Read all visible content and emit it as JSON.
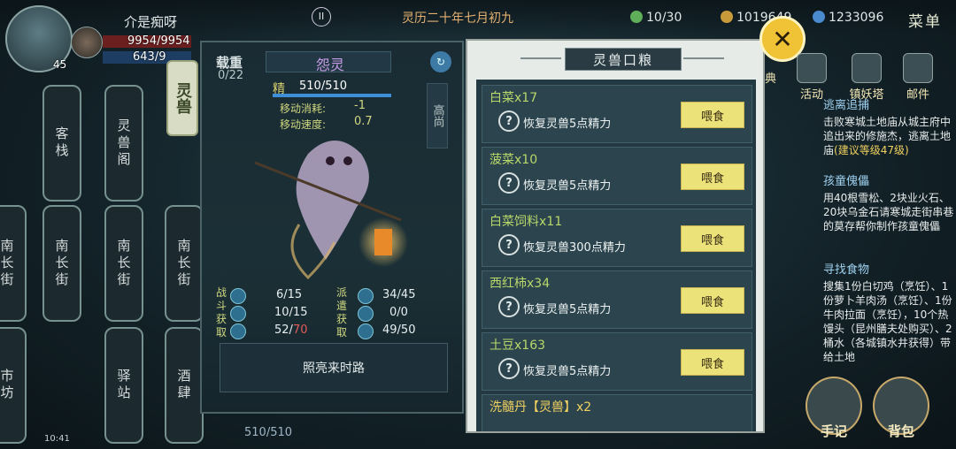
{
  "hud": {
    "player_name": "介是痴呀",
    "hp": "9954/9954",
    "mp": "643/9",
    "level": "45",
    "calendar": "灵历二十年七月初九",
    "stamina_res": "10/30",
    "copper": "1019649",
    "silver": "1233096",
    "menu_label": "菜单",
    "clock": "10:41"
  },
  "map": {
    "tab_label": "灵兽",
    "nodes": [
      "客栈",
      "灵兽阁",
      "南长街",
      "南长街",
      "南长街",
      "南长街",
      "驿站",
      "酒肆",
      "市坊"
    ]
  },
  "pet": {
    "weight_label": "载重",
    "weight_value": "0/22",
    "name": "怨灵",
    "stamina_label": "精",
    "stamina": "510/510",
    "move_cost_label": "移动消耗:",
    "move_cost": "-1",
    "move_speed_label": "移动速度:",
    "move_speed": "0.7",
    "side_tag": "高尚",
    "battle_label": "战斗获取",
    "dispatch_label": "派遣获取",
    "battle": [
      "6/15",
      "10/15",
      "52",
      "70"
    ],
    "dispatch": [
      "34/45",
      "0/0",
      "49/50"
    ],
    "skill": "照亮来时路",
    "below_stamina": "510/510"
  },
  "food_panel": {
    "title": "灵兽口粮",
    "feed_label": "喂食",
    "items": [
      {
        "name": "白菜x17",
        "desc": "恢复灵兽5点精力"
      },
      {
        "name": "菠菜x10",
        "desc": "恢复灵兽5点精力"
      },
      {
        "name": "白菜饲料x11",
        "desc": "恢复灵兽300点精力"
      },
      {
        "name": "西红柿x34",
        "desc": "恢复灵兽5点精力"
      },
      {
        "name": "土豆x163",
        "desc": "恢复灵兽5点精力"
      },
      {
        "name": "洗髓丹【灵兽】x2",
        "desc": ""
      }
    ]
  },
  "side_menu": {
    "buttons": [
      "活动",
      "镇妖塔",
      "邮件"
    ],
    "partial_left": "典",
    "big_buttons": [
      "手记",
      "背包"
    ]
  },
  "quests": [
    {
      "title": "逃离追捕",
      "text": "击败寒城土地庙从城主府中追出来的修施杰，逃离土地庙",
      "hint": "(建议等级47级)"
    },
    {
      "title": "孩童傀儡",
      "text": "用40根雪松、2块业火石、20块乌金石请寒城走街串巷的莫存帮你制作孩童傀儡",
      "hint": ""
    },
    {
      "title": "寻找食物",
      "text": "搜集1份白切鸡（烹饪）、1份萝卜羊肉汤（烹饪）、1份牛肉拉面（烹饪），10个热馒头（昆州膳夫处购买）、2桶水（各城镇水井获得）带给土地",
      "hint": ""
    }
  ]
}
